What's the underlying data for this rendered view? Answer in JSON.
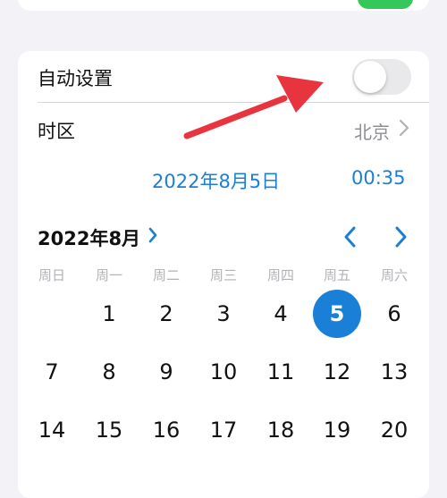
{
  "settings": {
    "auto_set_label": "自动设置",
    "auto_set_enabled": false,
    "timezone_label": "时区",
    "timezone_value": "北京"
  },
  "selected": {
    "date": "2022年8月5日",
    "time": "00:35"
  },
  "calendar": {
    "month_title": "2022年8月",
    "weekdays": [
      "周日",
      "周一",
      "周二",
      "周三",
      "周四",
      "周五",
      "周六"
    ],
    "weeks": [
      [
        "",
        "1",
        "2",
        "3",
        "4",
        "5",
        "6"
      ],
      [
        "7",
        "8",
        "9",
        "10",
        "11",
        "12",
        "13"
      ],
      [
        "14",
        "15",
        "16",
        "17",
        "18",
        "19",
        "20"
      ]
    ],
    "selected_day": "5"
  },
  "icons": {
    "chevron_right": "chevron-right-icon",
    "prev_month": "chevron-left-icon",
    "next_month": "chevron-right-icon",
    "annotation": "red-arrow-annotation"
  },
  "colors": {
    "accent": "#1a7fd6",
    "toggle_off": "#e9e9eb",
    "toggle_on": "#34c759",
    "arrow": "#e8343f",
    "background": "#f2f2f7"
  }
}
